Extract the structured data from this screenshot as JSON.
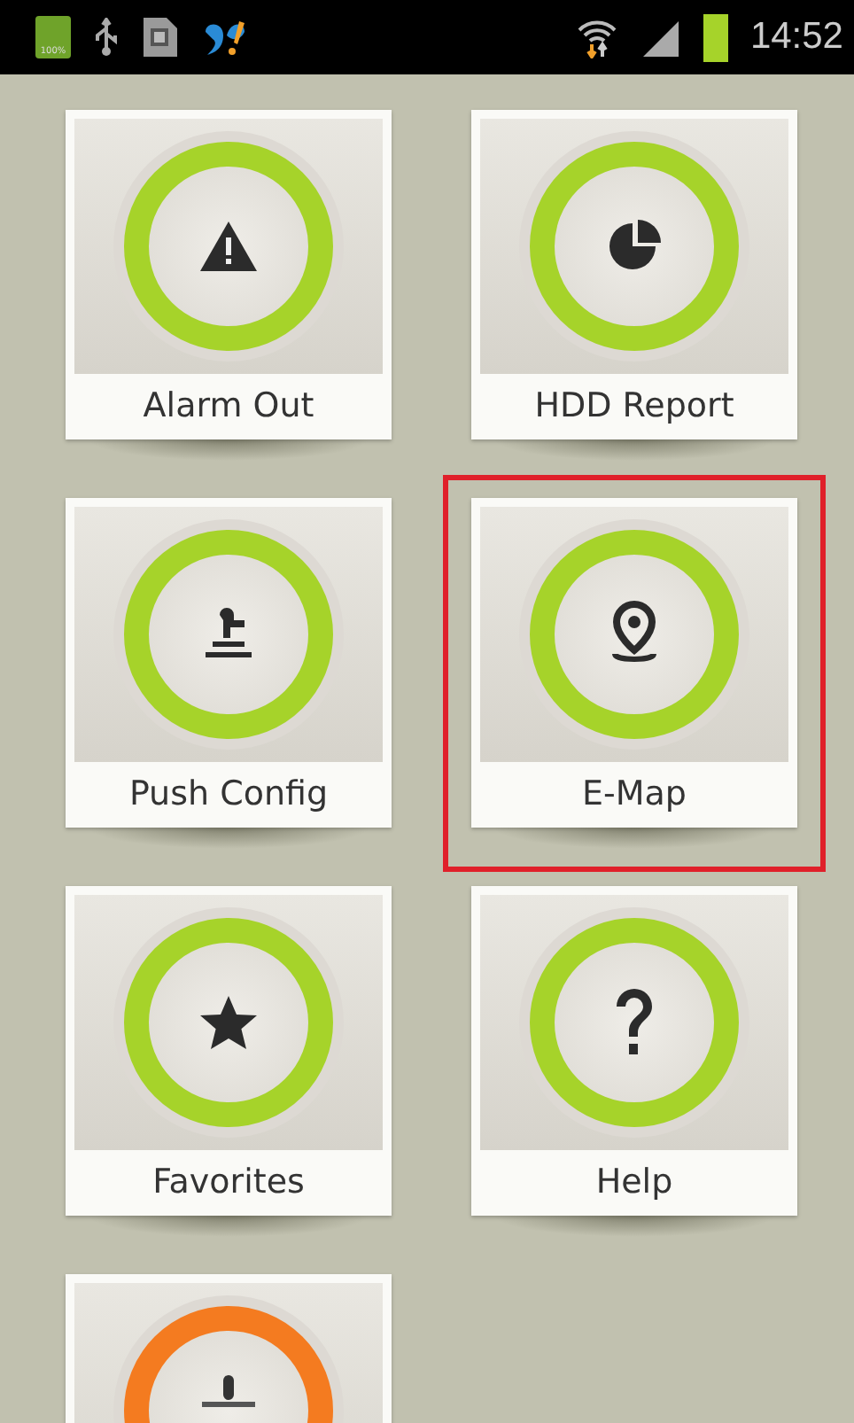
{
  "status_bar": {
    "battery_label": "100%",
    "time": "14:52"
  },
  "tiles": [
    {
      "label": "Alarm Out",
      "color": "#a6d32a",
      "selected": false
    },
    {
      "label": "HDD Report",
      "color": "#a6d32a",
      "selected": false
    },
    {
      "label": "Push Config",
      "color": "#a6d32a",
      "selected": false
    },
    {
      "label": "E-Map",
      "color": "#a6d32a",
      "selected": true
    },
    {
      "label": "Favorites",
      "color": "#a6d32a",
      "selected": false
    },
    {
      "label": "Help",
      "color": "#a6d32a",
      "selected": false
    },
    {
      "color": "#f47b20",
      "selected": false
    }
  ]
}
